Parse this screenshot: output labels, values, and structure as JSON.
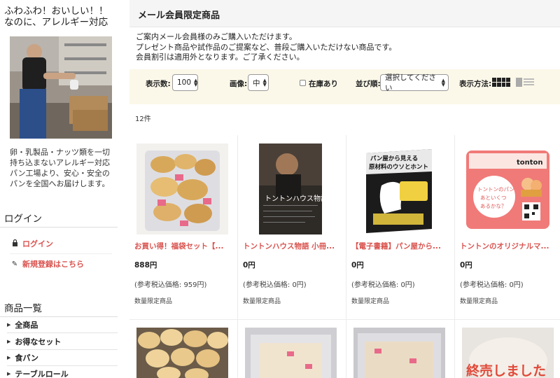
{
  "sidebar": {
    "tagline": [
      "ふわふわ！おいしい！！",
      "なのに、アレルギー対応"
    ],
    "description": [
      "卵・乳製品・ナッツ類を一切",
      "持ち込まないアレルギー対応",
      "パン工場より、安心・安全の",
      "パンを全国へお届けします。"
    ],
    "login_heading": "ログイン",
    "login_link": "ログイン",
    "register_link": "新規登録はこちら",
    "category_heading": "商品一覧",
    "categories": [
      "全商品",
      "お得なセット",
      "食パン",
      "テーブルロール"
    ]
  },
  "main": {
    "title": "メール会員限定商品",
    "intro": [
      "ご案内メール会員様のみご購入いただけます。",
      "プレゼント商品や試作品のご提案など、普段ご購入いただけない商品です。",
      "会員割引は適用外となります。ご了承ください。"
    ],
    "toolbar": {
      "display_count_label": "表示数:",
      "display_count_value": "100",
      "image_label": "画像:",
      "image_value": "中",
      "in_stock_label": "在庫あり",
      "sort_label": "並び順:",
      "sort_value": "選択してください",
      "view_mode_label": "表示方法:"
    },
    "result_count": "12件",
    "products": [
      {
        "title": "お買い得！福袋セット【...",
        "price": "888円",
        "ref_price": "(参考税込価格: 959円)",
        "limited": "数量限定商品"
      },
      {
        "title": "トントンハウス物語 小冊...",
        "price": "0円",
        "ref_price": "(参考税込価格: 0円)",
        "limited": "数量限定商品",
        "image_text": "トントンハウス物語"
      },
      {
        "title": "【電子書籍】パン屋から...",
        "price": "0円",
        "ref_price": "(参考税込価格: 0円)",
        "limited": "数量限定商品",
        "image_text": [
          "パン屋から見える",
          "原材料のウソとホント"
        ]
      },
      {
        "title": "トントンのオリジナルマ...",
        "price": "0円",
        "ref_price": "(参考税込価格: 0円)",
        "limited": "数量限定商品",
        "image_text": [
          "トントンのパン",
          "あといくつ",
          "あるかな？"
        ],
        "image_brand": "tonton"
      }
    ],
    "second_row_sold_out": "終売しました"
  },
  "colors": {
    "accent_red": "#d9534f",
    "toolbar_bg": "#fbf8e9",
    "title_bar_bg": "#f5f5f5"
  }
}
